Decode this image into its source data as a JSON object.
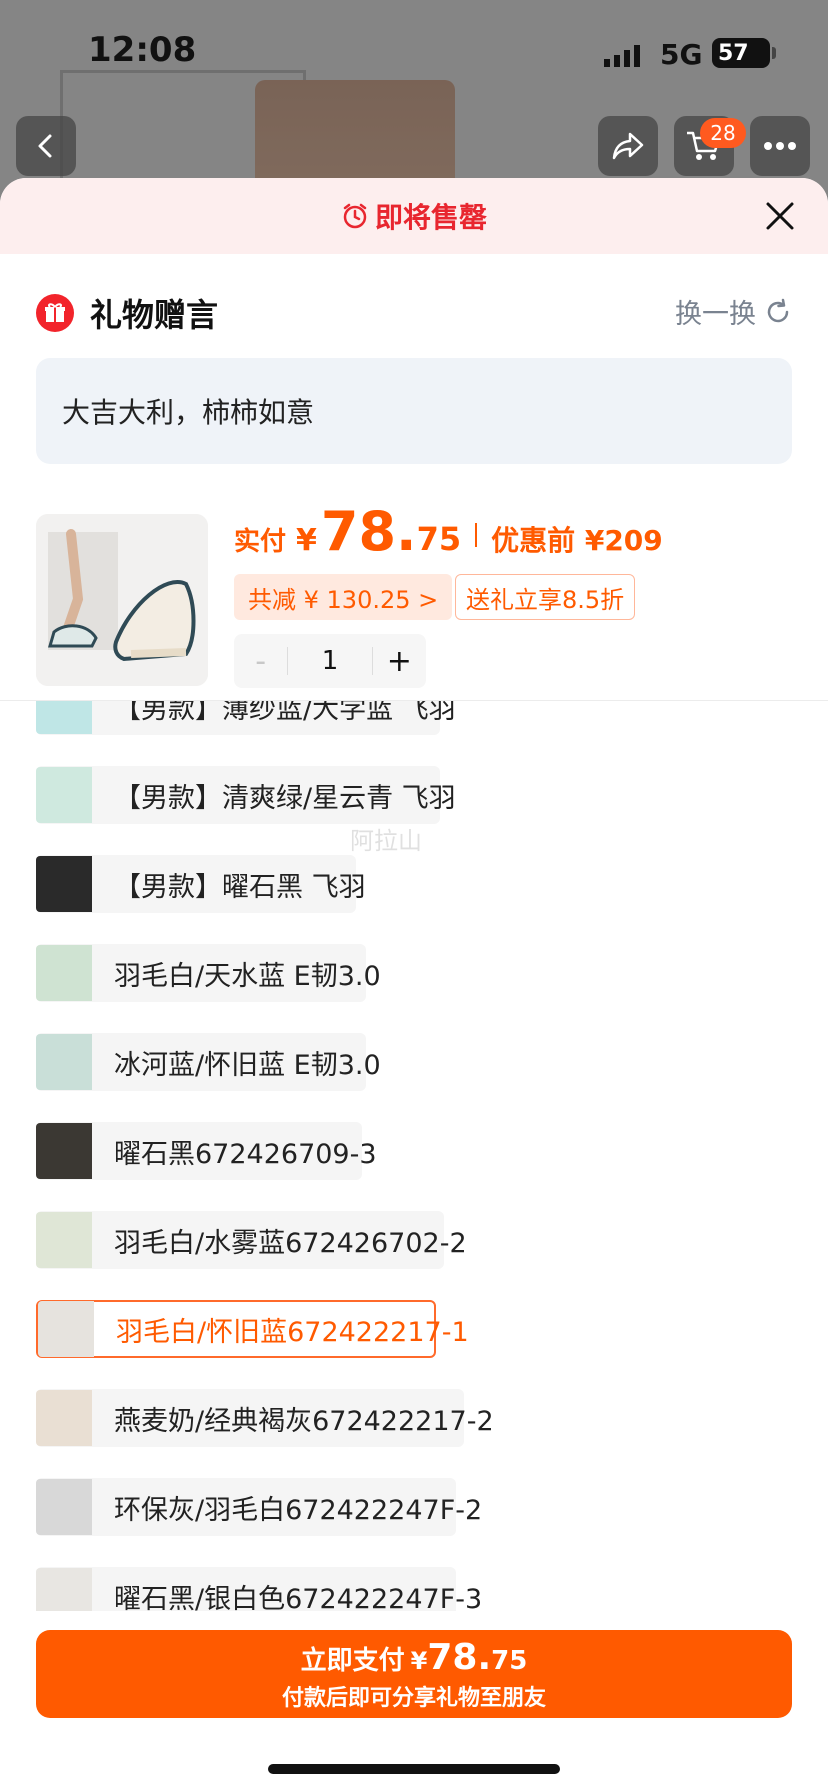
{
  "status_bar": {
    "time": "12:08",
    "network": "5G",
    "battery": "57"
  },
  "header": {
    "cart_badge": "28"
  },
  "sheet": {
    "banner_text": "即将售罄",
    "gift_title": "礼物赠言",
    "refresh_label": "换一换",
    "message": "大吉大利，柿柿如意"
  },
  "price": {
    "prefix": "实付",
    "currency": "¥",
    "integer": "78.",
    "decimal": "75",
    "before_discount": "优惠前 ¥209",
    "total_discount": "共减 ¥ 130.25 >",
    "gift_discount": "送礼立享8.5折"
  },
  "quantity": {
    "minus": "-",
    "value": "1",
    "plus": "+"
  },
  "variants": [
    {
      "name": "【男款】薄纱蓝/大学蓝 飞羽",
      "thumb_color": "#bfe6e6",
      "selected": false
    },
    {
      "name": "【男款】清爽绿/星云青 飞羽",
      "thumb_color": "#cfe9df",
      "selected": false
    },
    {
      "name": "【男款】曜石黑 飞羽",
      "thumb_color": "#2a2a2a",
      "selected": false
    },
    {
      "name": "羽毛白/天水蓝 E韧3.0",
      "thumb_color": "#cfe3d2",
      "selected": false
    },
    {
      "name": "冰河蓝/怀旧蓝 E韧3.0",
      "thumb_color": "#c9dfd8",
      "selected": false
    },
    {
      "name": "曜石黑672426709-3",
      "thumb_color": "#3b3833",
      "selected": false
    },
    {
      "name": "羽毛白/水雾蓝672426702-2",
      "thumb_color": "#dfe6d6",
      "selected": false
    },
    {
      "name": "羽毛白/怀旧蓝672422217-1",
      "thumb_color": "#e6e3de",
      "selected": true
    },
    {
      "name": "燕麦奶/经典褐灰672422217-2",
      "thumb_color": "#e9dfd3",
      "selected": false
    },
    {
      "name": "环保灰/羽毛白672422247F-2",
      "thumb_color": "#d8d8d8",
      "selected": false
    },
    {
      "name": "曜石黑/银白色672422247F-3",
      "thumb_color": "#e8e6e2",
      "selected": false
    }
  ],
  "watermark": "阿拉山",
  "pay": {
    "label": "立即支付",
    "currency": "¥",
    "integer": "78.",
    "decimal": "75",
    "subtitle": "付款后即可分享礼物至朋友"
  },
  "colors": {
    "accent": "#ff5a00",
    "alert": "#e8262f",
    "selected_border": "#ff6a2b"
  }
}
